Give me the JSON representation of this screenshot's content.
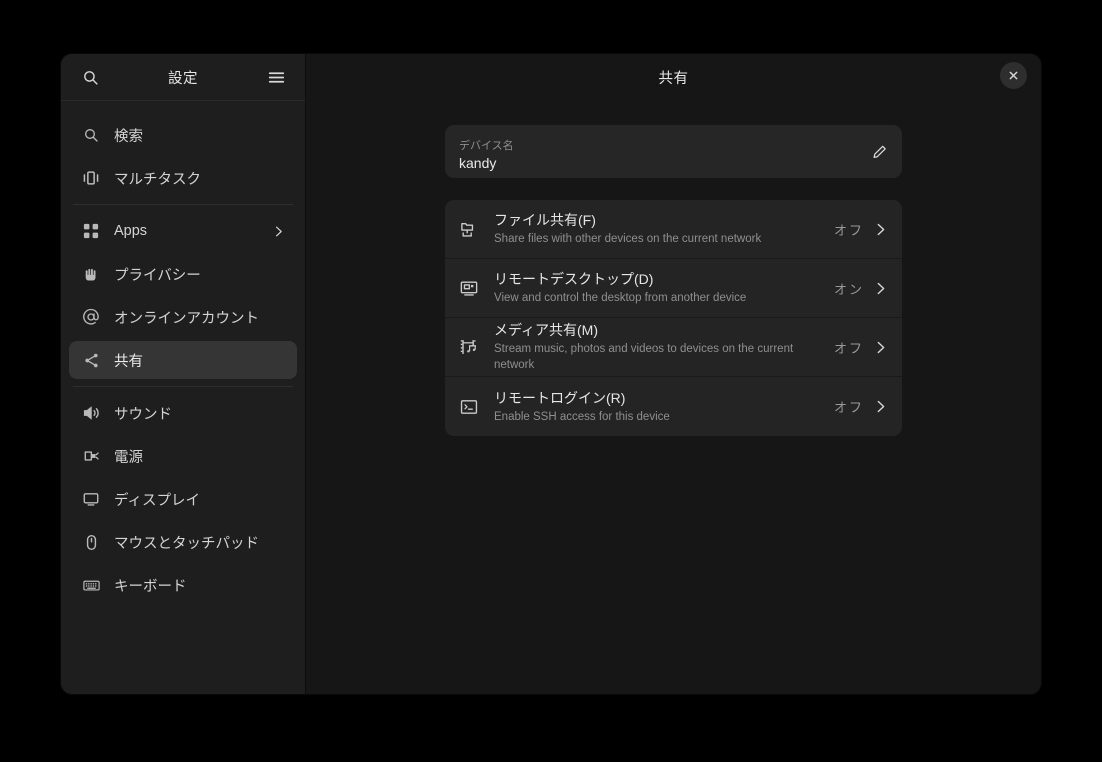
{
  "colors": {
    "desktop_bg": "#000000",
    "sidebar_bg": "#1e1e1e",
    "content_bg": "#161616",
    "card_bg": "#242424",
    "device_card_bg": "#262626",
    "selected_row_bg": "#353535",
    "text_primary": "#e6e6e6",
    "text_secondary": "#8f8f8f"
  },
  "sidebar": {
    "header": {
      "search_icon": "search-icon",
      "title": "設定",
      "menu_icon": "hamburger-menu-icon"
    },
    "groups": [
      {
        "items": [
          {
            "label": "検索",
            "icon": "search-icon",
            "selected": false,
            "chevron": false
          },
          {
            "label": "マルチタスク",
            "icon": "multitask-panels-icon",
            "selected": false,
            "chevron": false
          }
        ]
      },
      {
        "items": [
          {
            "label": "Apps",
            "icon": "apps-grid-icon",
            "selected": false,
            "chevron": true
          },
          {
            "label": "プライバシー",
            "icon": "privacy-hand-icon",
            "selected": false,
            "chevron": false
          },
          {
            "label": "オンラインアカウント",
            "icon": "at-sign-icon",
            "selected": false,
            "chevron": false
          },
          {
            "label": "共有",
            "icon": "share-nodes-icon",
            "selected": true,
            "chevron": false
          }
        ]
      },
      {
        "items": [
          {
            "label": "サウンド",
            "icon": "speaker-icon",
            "selected": false,
            "chevron": false
          },
          {
            "label": "電源",
            "icon": "battery-power-icon",
            "selected": false,
            "chevron": false
          },
          {
            "label": "ディスプレイ",
            "icon": "display-monitor-icon",
            "selected": false,
            "chevron": false
          },
          {
            "label": "マウスとタッチパッド",
            "icon": "mouse-icon",
            "selected": false,
            "chevron": false
          },
          {
            "label": "キーボード",
            "icon": "keyboard-icon",
            "selected": false,
            "chevron": false
          }
        ]
      }
    ]
  },
  "content": {
    "title": "共有",
    "close_icon": "close-icon",
    "close_label": "×",
    "device_name": {
      "label": "デバイス名",
      "value": "kandy",
      "edit_icon": "pencil-edit-icon"
    },
    "rows": [
      {
        "title": "ファイル共有(F)",
        "subtitle": "Share files with other devices on the current network",
        "status": "オフ",
        "icon": "file-sharing-icon",
        "chevron_icon": "chevron-right-icon"
      },
      {
        "title": "リモートデスクトップ(D)",
        "subtitle": "View and control the desktop from another device",
        "status": "オン",
        "icon": "remote-desktop-icon",
        "chevron_icon": "chevron-right-icon"
      },
      {
        "title": "メディア共有(M)",
        "subtitle": "Stream music, photos and videos to devices on the current network",
        "status": "オフ",
        "icon": "media-sharing-icon",
        "chevron_icon": "chevron-right-icon"
      },
      {
        "title": "リモートログイン(R)",
        "subtitle": "Enable SSH access for this device",
        "status": "オフ",
        "icon": "remote-login-terminal-icon",
        "chevron_icon": "chevron-right-icon"
      }
    ]
  }
}
